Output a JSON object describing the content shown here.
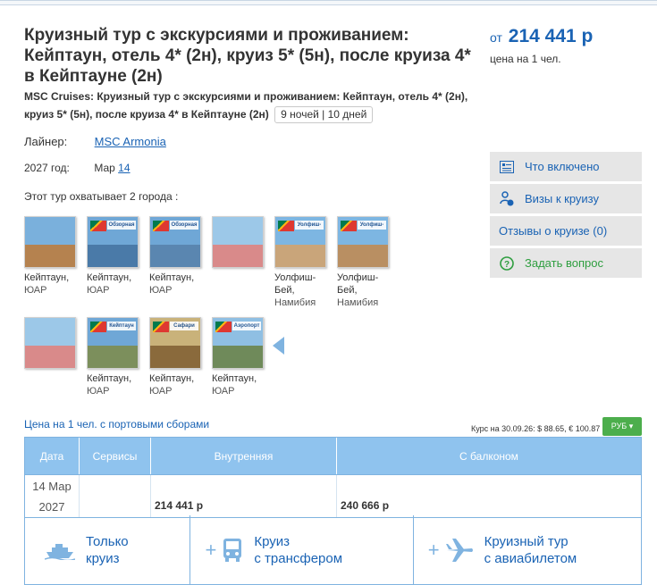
{
  "tour": {
    "title": "Круизный тур с экскурсиями и проживанием: Кейптаун, отель 4* (2н), круиз 5* (5н), после круиза 4* в Кейптауне (2н)",
    "subtitle": "MSC Cruises: Круизный тур с экскурсиями и проживанием: Кейптаун, отель 4* (2н), круиз 5* (5н), после круиза 4* в Кейптауне (2н)",
    "duration_badge": "9 ночей | 10 дней"
  },
  "price": {
    "prefix": "от",
    "amount": "214 441 р",
    "note": "цена на 1 чел."
  },
  "info": {
    "liner_label": "Лайнер:",
    "liner_value": "MSC Armonia",
    "year_label": "2027 год:",
    "month": "Мар",
    "day": "14"
  },
  "cities_caption": "Этот тур охватывает 2 города :",
  "gallery": [
    {
      "city": "Кейптаун,",
      "country": "ЮАР",
      "band": "",
      "sky": "#7ab0dc",
      "ground": "#b5824f"
    },
    {
      "city": "Кейптаун,",
      "country": "ЮАР",
      "band": "Обзорная экск.",
      "sky": "#6fa7d6",
      "ground": "#4a7aa8"
    },
    {
      "city": "Кейптаун,",
      "country": "ЮАР",
      "band": "Обзорная экск.",
      "sky": "#6fa7d6",
      "ground": "#5a86b0"
    },
    {
      "city": "",
      "country": "",
      "band": "",
      "sky": "#9cc8e8",
      "ground": "#d98a8a"
    },
    {
      "city": "Уолфиш-Бей,",
      "country": "Намибия",
      "band": "Уолфиш-Бей",
      "sky": "#7db6e2",
      "ground": "#c9a57a"
    },
    {
      "city": "Уолфиш-Бей,",
      "country": "Намибия",
      "band": "Уолфиш-Бей",
      "sky": "#7db6e2",
      "ground": "#b98f62"
    },
    {
      "city": "",
      "country": "",
      "band": "",
      "sky": "#9cc8e8",
      "ground": "#d98a8a"
    },
    {
      "city": "Кейптаун,",
      "country": "ЮАР",
      "band": "Кейптаун",
      "sky": "#6fa7d6",
      "ground": "#7c8f5c"
    },
    {
      "city": "Кейптаун,",
      "country": "ЮАР",
      "band": "Сафари",
      "sky": "#c9b27a",
      "ground": "#8a6a3c"
    },
    {
      "city": "Кейптаун,",
      "country": "ЮАР",
      "band": "Аэропорт",
      "sky": "#8fbfe3",
      "ground": "#6f8a5a"
    }
  ],
  "side_buttons": [
    {
      "label": "Что включено",
      "icon": "list-icon"
    },
    {
      "label": "Визы к круизу",
      "icon": "visa-icon"
    },
    {
      "label": "Отзывы о круизе (0)",
      "icon": ""
    },
    {
      "label": "Задать вопрос",
      "icon": "question-icon"
    }
  ],
  "price_note": "Цена на 1 чел. с портовыми сборами",
  "rate_note": "Курс на 30.09.26: $ 88.65, € 100.87",
  "currency": "РУБ ▾",
  "table": {
    "headers": [
      "Дата",
      "Сервисы",
      "Внутренняя",
      "С балконом"
    ],
    "rows": [
      {
        "date_day": "14 Мар",
        "date_year": "2027",
        "services": "",
        "inner": "214 441 р",
        "balcony": "240 666 р"
      }
    ]
  },
  "options": [
    {
      "line1": "Только",
      "line2": "круиз"
    },
    {
      "line1": "Круиз",
      "line2": "с трансфером"
    },
    {
      "line1": "Круизный тур",
      "line2": "с авиабилетом"
    }
  ],
  "colors": {
    "accent": "#1a63b4",
    "header": "#8fc3ee",
    "green": "#4cae4c"
  }
}
